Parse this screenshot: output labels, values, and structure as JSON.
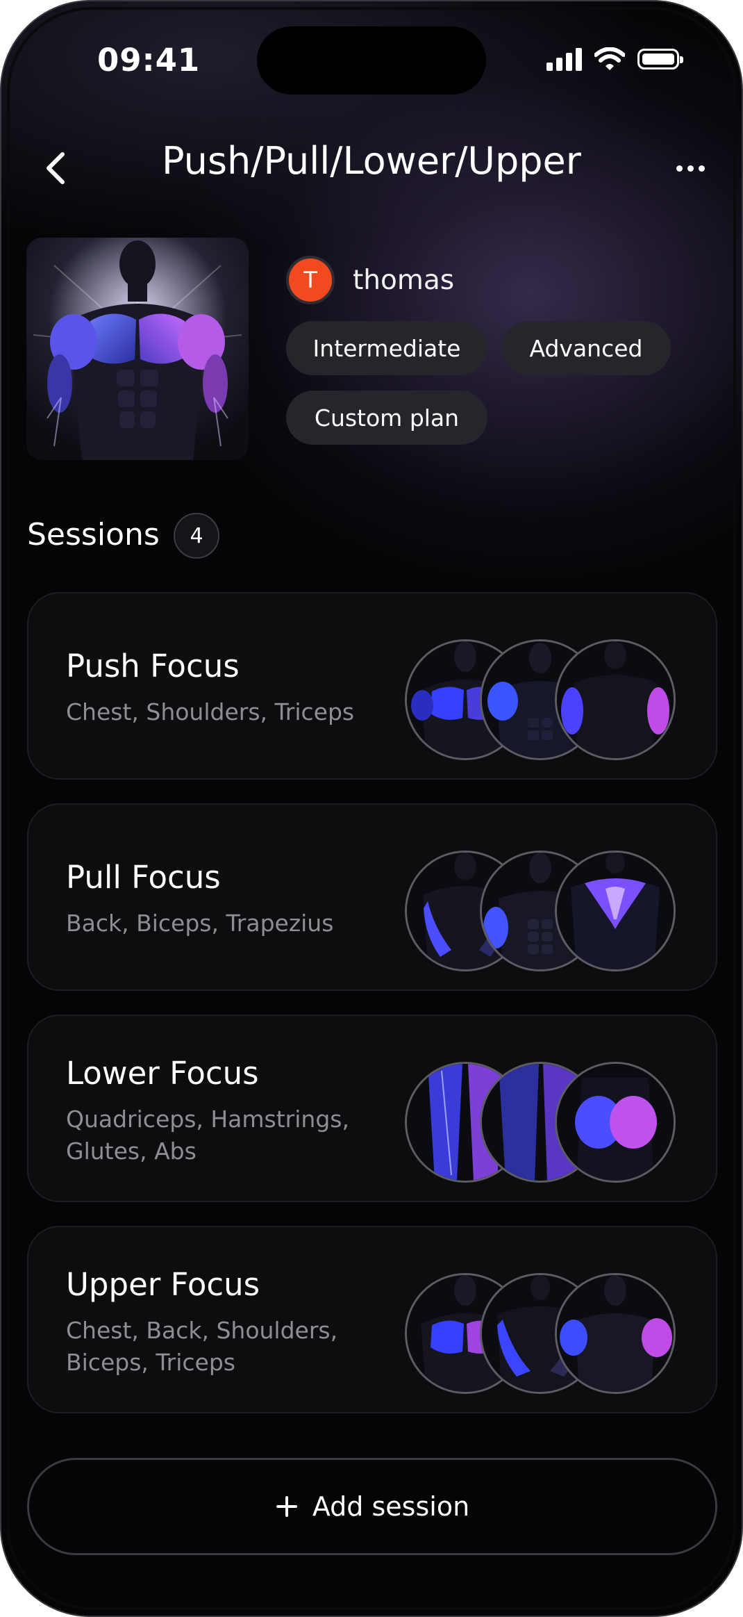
{
  "status_bar": {
    "time": "09:41"
  },
  "header": {
    "title": "Push/Pull/Lower/Upper"
  },
  "plan": {
    "author": {
      "initial": "T",
      "name": "thomas",
      "avatar_color": "#f04a1e"
    },
    "tags": [
      "Intermediate",
      "Advanced",
      "Custom plan"
    ]
  },
  "sessions": {
    "title": "Sessions",
    "count": "4",
    "items": [
      {
        "name": "Push Focus",
        "muscles": "Chest, Shoulders, Triceps",
        "thumb_icons": [
          "chest-front-icon",
          "shoulders-front-icon",
          "triceps-back-icon"
        ]
      },
      {
        "name": "Pull Focus",
        "muscles": "Back, Biceps, Trapezius",
        "thumb_icons": [
          "lats-back-icon",
          "biceps-front-icon",
          "trapezius-back-icon"
        ]
      },
      {
        "name": "Lower Focus",
        "muscles": "Quadriceps, Hamstrings, Glutes, Abs",
        "thumb_icons": [
          "quadriceps-icon",
          "hamstrings-icon",
          "glutes-icon"
        ]
      },
      {
        "name": "Upper Focus",
        "muscles": "Chest, Back, Shoulders, Biceps, Triceps",
        "thumb_icons": [
          "chest-front-icon",
          "back-icon",
          "arms-front-icon"
        ]
      }
    ]
  },
  "add_session": {
    "label": "Add session",
    "icon": "plus-icon"
  },
  "colors": {
    "accent_blue": "#3b4dff",
    "accent_purple": "#b04ce6",
    "background": "#050507"
  }
}
